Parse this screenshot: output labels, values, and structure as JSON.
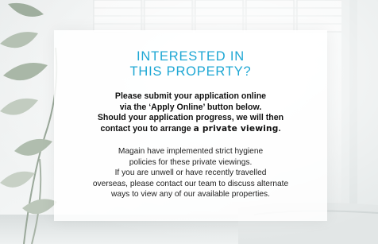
{
  "headline": {
    "line1": "INTERESTED IN",
    "line2": "THIS PROPERTY?"
  },
  "instructions": {
    "line1": "Please submit your application online",
    "line2": "via the ‘Apply Online’ button below.",
    "line3": "Should your application progress, we will then",
    "line4_prefix": "contact you to arrange ",
    "line4_emphasis": "a private viewing",
    "line4_suffix": "."
  },
  "hygiene_notice": {
    "line1": "Magain have implemented strict hygiene",
    "line2": "policies for these private viewings.",
    "line3": "If you are unwell or have recently travelled",
    "line4": "overseas, please contact our team to discuss alternate",
    "line5": "ways to view any of our available properties."
  },
  "colors": {
    "headline": "#1ea7d4",
    "body_text": "#111111",
    "panel_bg": "#ffffff"
  }
}
